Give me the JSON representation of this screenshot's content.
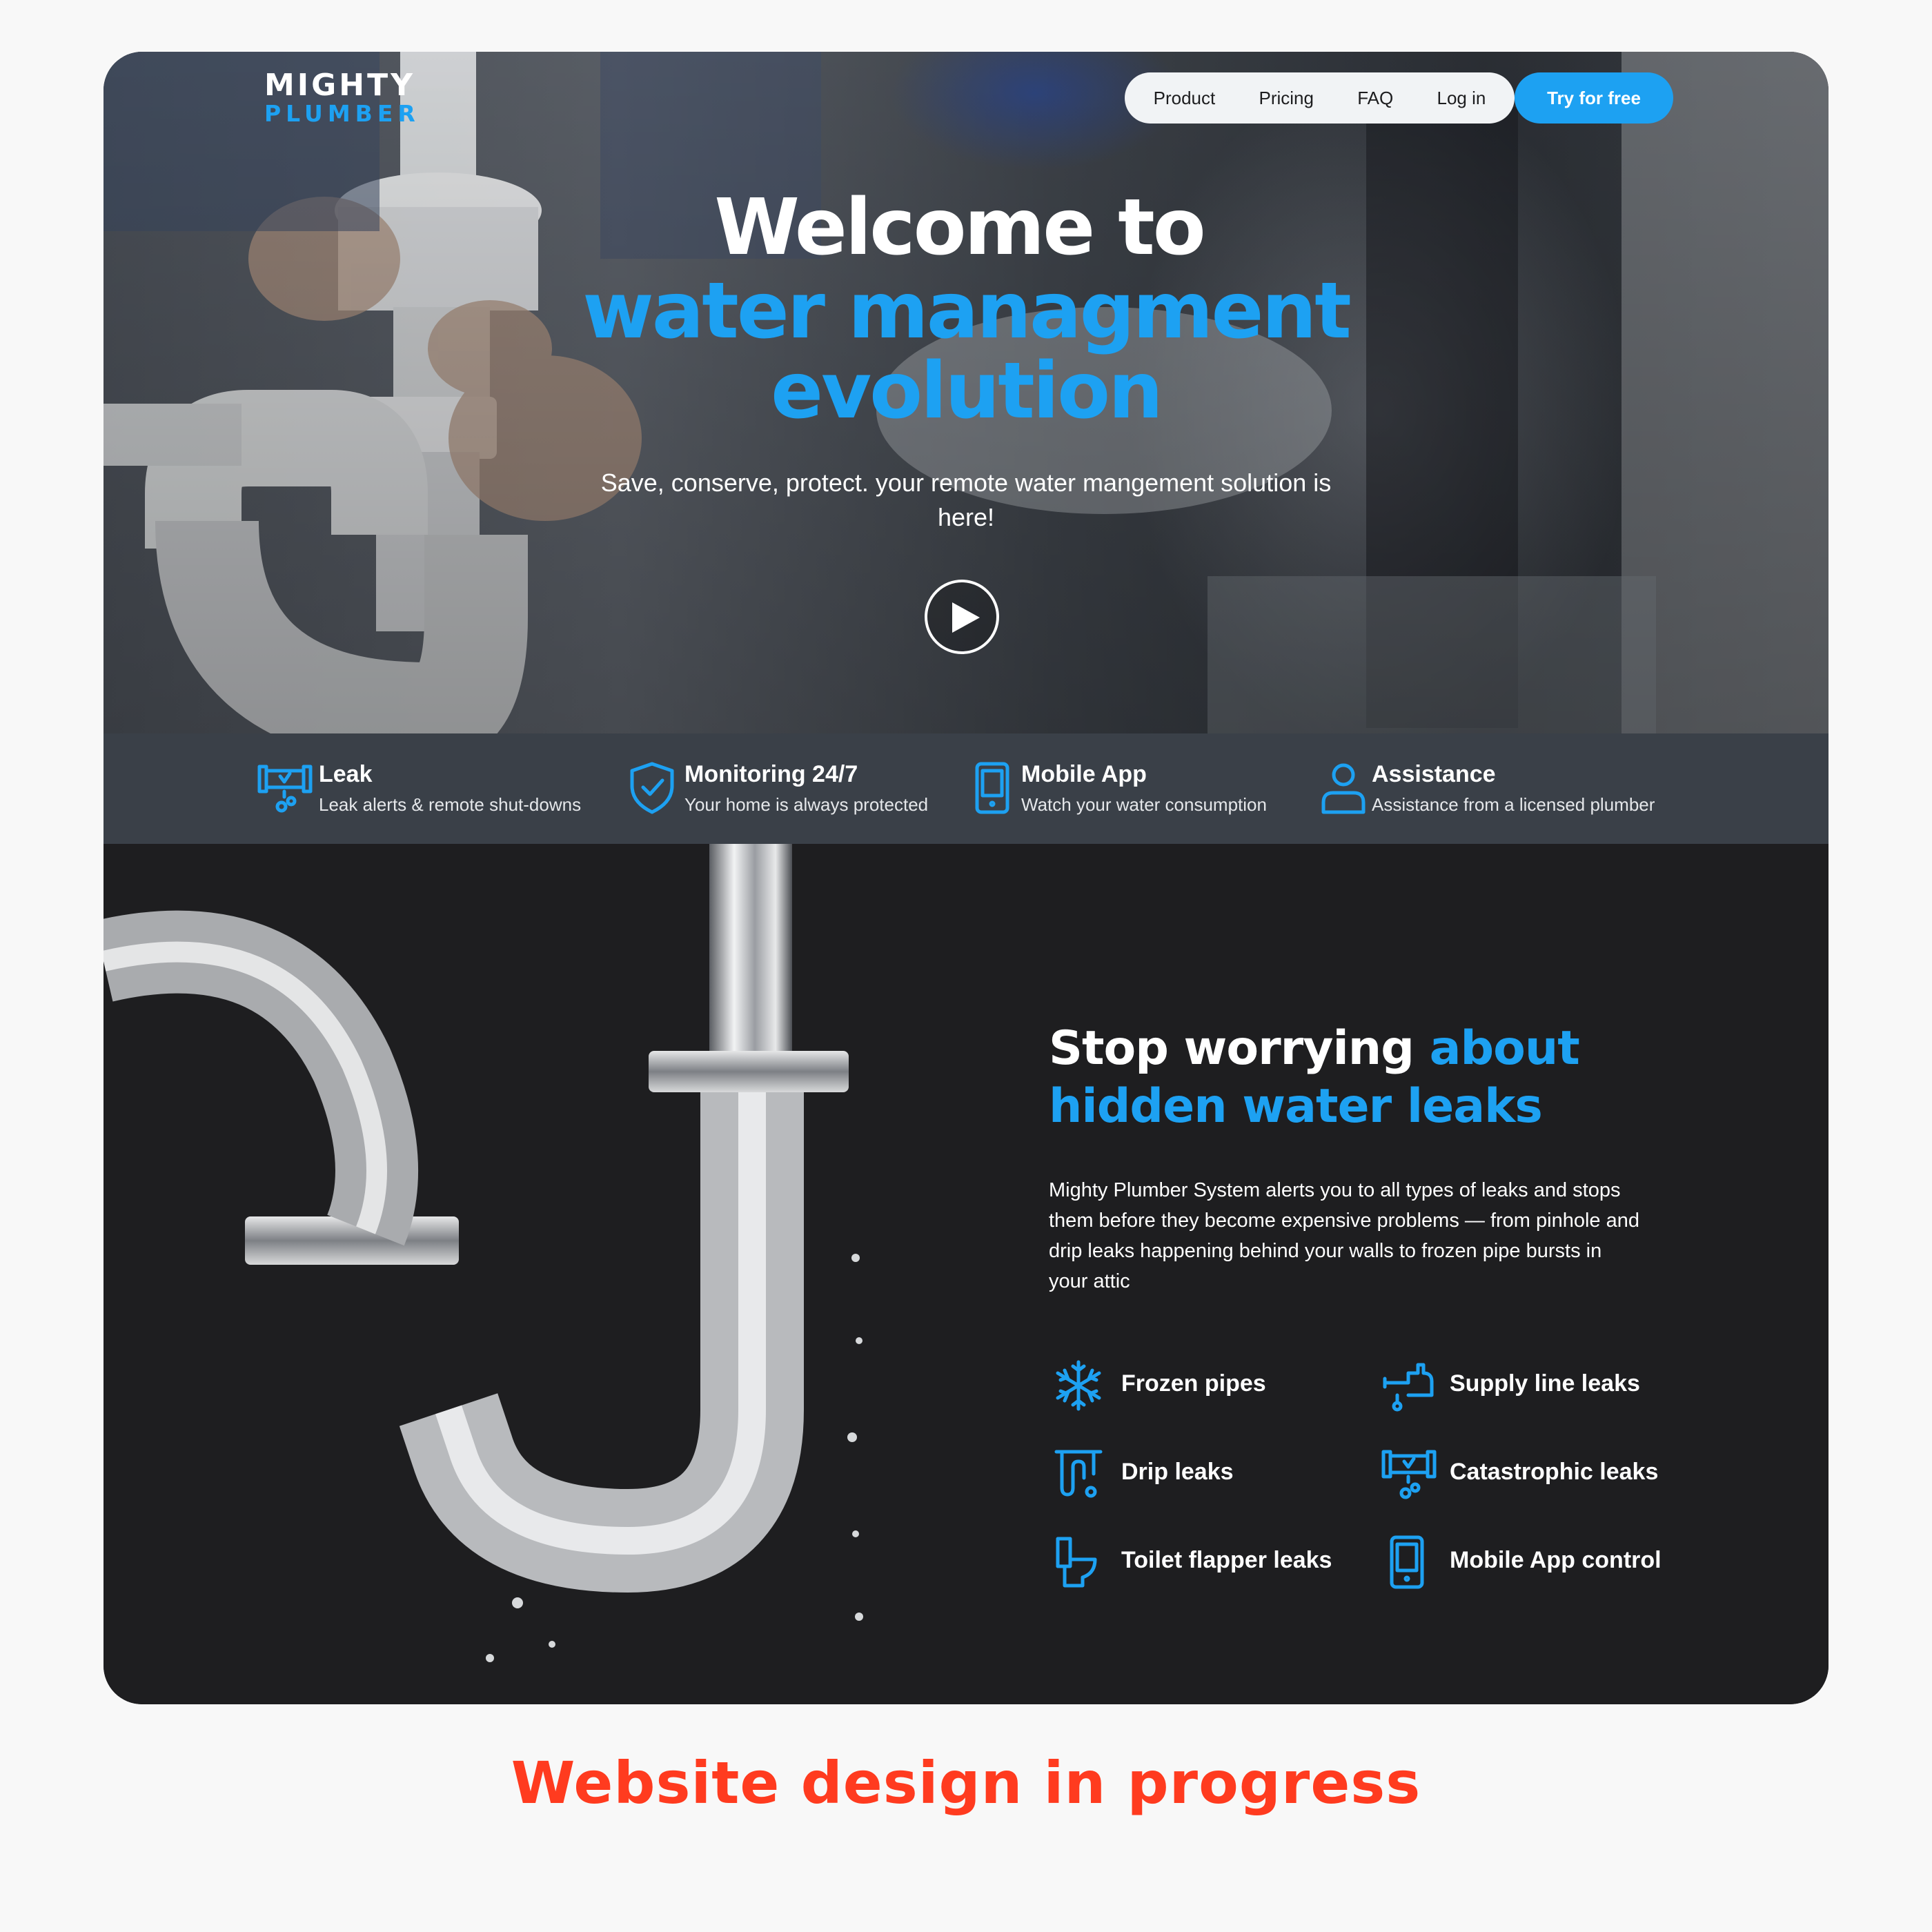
{
  "brand": {
    "line1": "MIGHTY",
    "line2": "PLUMBER"
  },
  "nav": {
    "items": [
      "Product",
      "Pricing",
      "FAQ",
      "Log in"
    ],
    "cta": "Try for free"
  },
  "hero": {
    "title_line1": "Welcome to",
    "title_line2": "water managment",
    "title_line3": "evolution",
    "subtitle": "Save, conserve, protect. your remote water mangement solution is here!"
  },
  "features": [
    {
      "icon": "leak-pipe-icon",
      "title": "Leak",
      "desc": "Leak alerts & remote shut-downs"
    },
    {
      "icon": "shield-check-icon",
      "title": "Monitoring 24/7",
      "desc": "Your home is always protected"
    },
    {
      "icon": "smartphone-icon",
      "title": "Mobile App",
      "desc": "Watch your water consumption"
    },
    {
      "icon": "user-icon",
      "title": "Assistance",
      "desc": "Assistance from a licensed plumber"
    }
  ],
  "leaks_section": {
    "title_white": "Stop worrying",
    "title_blue_1": "about",
    "title_blue_2": "hidden water leaks",
    "body": "Mighty Plumber System alerts you to all types of leaks and stops them before they become expensive problems — from pinhole and drip leaks happening behind your walls to frozen pipe bursts in your attic",
    "tiles": [
      {
        "icon": "snowflake-icon",
        "label": "Frozen pipes"
      },
      {
        "icon": "supply-line-icon",
        "label": "Supply line leaks"
      },
      {
        "icon": "drip-icon",
        "label": "Drip leaks"
      },
      {
        "icon": "burst-pipe-icon",
        "label": "Catastrophic leaks"
      },
      {
        "icon": "toilet-icon",
        "label": "Toilet flapper leaks"
      },
      {
        "icon": "smartphone-icon",
        "label": "Mobile App control"
      }
    ]
  },
  "caption": "Website design in progress",
  "colors": {
    "accent": "#1da1f2",
    "caption": "#ff3b1f",
    "dark_bg": "#1e1e20",
    "nav_bg": "#f1f3f5"
  }
}
